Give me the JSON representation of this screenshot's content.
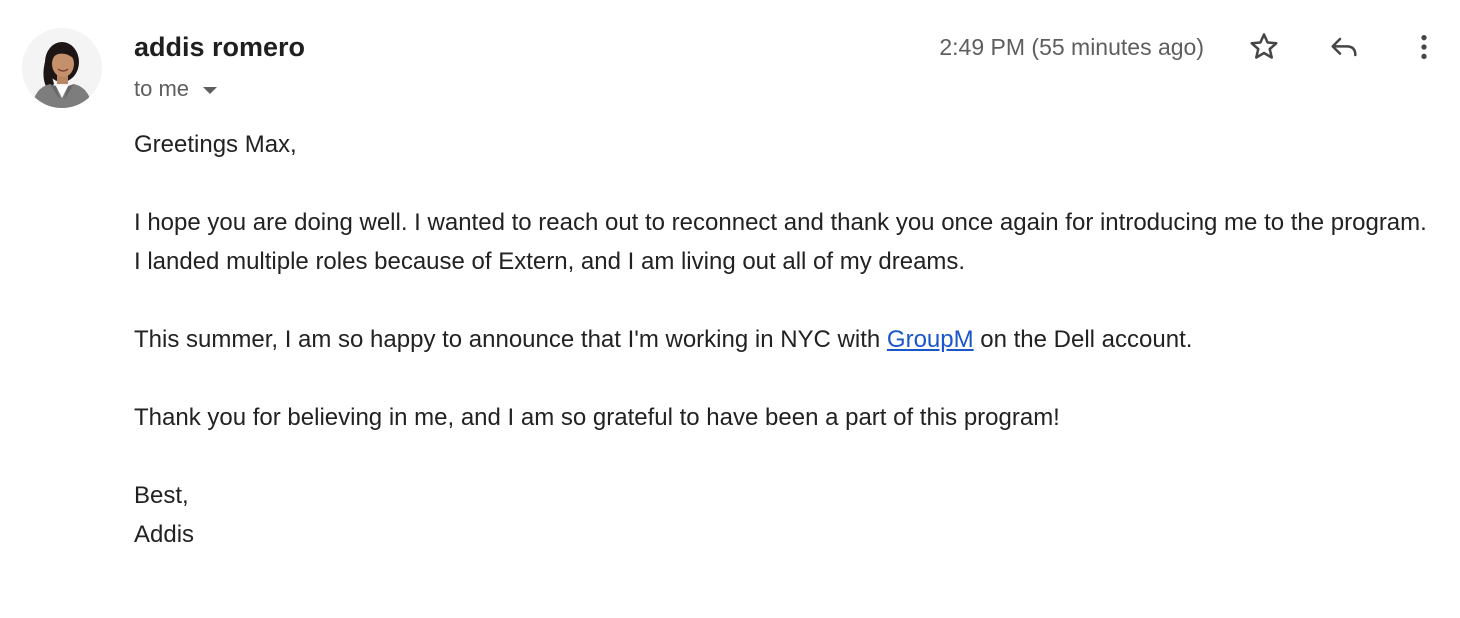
{
  "email": {
    "sender": {
      "name": "addis romero",
      "avatar_icon": "profile-photo"
    },
    "recipient_label": "to me",
    "timestamp": "2:49 PM (55 minutes ago)",
    "actions": {
      "star_icon": "star-outline-icon",
      "reply_icon": "reply-icon",
      "more_icon": "more-vert-icon"
    },
    "body": {
      "greeting": "Greetings Max,",
      "paragraph1": "I hope you are doing well. I wanted to reach out to reconnect and thank you once again for introducing me to the program. I landed multiple roles because of Extern, and I am living out all of my dreams.",
      "paragraph2_before": "This summer, I am so happy to announce that I'm working in NYC with ",
      "paragraph2_link": "GroupM",
      "paragraph2_after": " on the Dell account.",
      "paragraph3": "Thank you for believing in me, and I am so grateful to have been a part of this program!",
      "closing": "Best,",
      "signature": "Addis"
    },
    "colors": {
      "link": "#1a55c9",
      "secondary_text": "#5e5e5e",
      "body_text": "#222222"
    }
  }
}
